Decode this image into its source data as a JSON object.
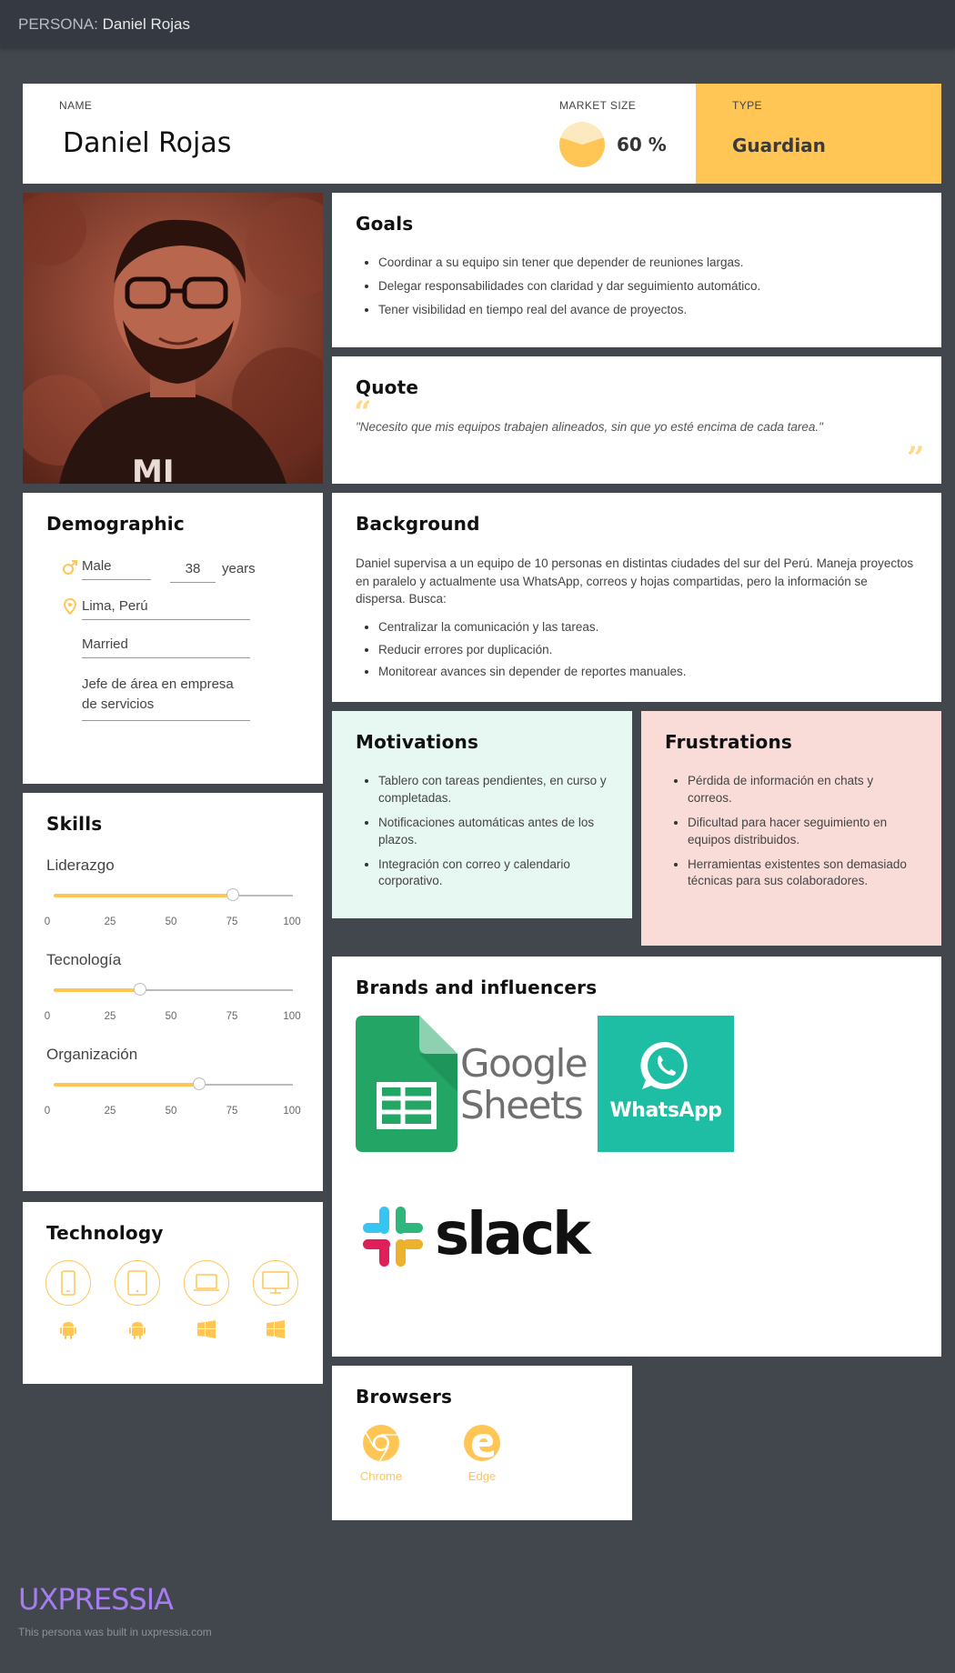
{
  "topbar": {
    "prefix": "PERSONA:",
    "name": "Daniel Rojas"
  },
  "header": {
    "name_label": "NAME",
    "name": "Daniel Rojas",
    "market_label": "MARKET SIZE",
    "market_value": "60 %",
    "market_fraction": 0.6,
    "type_label": "TYPE",
    "type": "Guardian"
  },
  "photo": {
    "alt": "Portrait of Daniel Rojas"
  },
  "goals": {
    "title": "Goals",
    "items": [
      "Coordinar a su equipo sin tener que depender de reuniones largas.",
      "Delegar responsabilidades con claridad y dar seguimiento automático.",
      "Tener visibilidad en tiempo real del avance de proyectos."
    ]
  },
  "quote": {
    "title": "Quote",
    "text": "\"Necesito que mis equipos trabajen alineados, sin que yo esté encima de cada tarea.\""
  },
  "demographic": {
    "title": "Demographic",
    "gender": "Male",
    "age": "38",
    "age_unit": "years",
    "location": "Lima, Perú",
    "status": "Married",
    "occupation": "Jefe de área en empresa de servicios"
  },
  "background": {
    "title": "Background",
    "paragraph": "Daniel supervisa a un equipo de 10 personas en distintas ciudades del sur del Perú. Maneja proyectos en paralelo y actualmente usa WhatsApp, correos y hojas compartidas, pero la información se dispersa. Busca:",
    "items": [
      "Centralizar la comunicación y las tareas.",
      "Reducir errores por duplicación.",
      "Monitorear avances sin depender de reportes manuales."
    ]
  },
  "motivations": {
    "title": "Motivations",
    "items": [
      "Tablero con tareas pendientes, en curso y completadas.",
      "Notificaciones automáticas antes de los plazos.",
      "Integración con correo y calendario corporativo."
    ]
  },
  "frustrations": {
    "title": "Frustrations",
    "items": [
      "Pérdida de información en chats y correos.",
      "Dificultad para hacer seguimiento en equipos distribuidos.",
      "Herramientas existentes son demasiado técnicas para sus colaboradores."
    ]
  },
  "skills": {
    "title": "Skills",
    "ticks": [
      "0",
      "25",
      "50",
      "75",
      "100"
    ],
    "items": [
      {
        "name": "Liderazgo",
        "value": 75
      },
      {
        "name": "Tecnología",
        "value": 36
      },
      {
        "name": "Organización",
        "value": 61
      }
    ]
  },
  "technology": {
    "title": "Technology",
    "devices": [
      "smartphone-icon",
      "tablet-icon",
      "laptop-icon",
      "desktop-icon"
    ],
    "os": [
      "android-icon",
      "android-icon",
      "windows-icon",
      "windows-icon"
    ]
  },
  "brands": {
    "title": "Brands and influencers",
    "items": [
      {
        "name": "Google Sheets",
        "line1": "Google",
        "line2": "Sheets"
      },
      {
        "name": "WhatsApp",
        "label": "WhatsApp"
      },
      {
        "name": "Slack",
        "label": "slack"
      }
    ]
  },
  "browsers": {
    "title": "Browsers",
    "items": [
      "Chrome",
      "Edge"
    ]
  },
  "footer": {
    "logo": "UXPRESSIA",
    "note": "This persona was built in uxpressia.com"
  },
  "colors": {
    "accent": "#ffc655",
    "page_bg": "#42464d",
    "motivations_bg": "#e7f7f2",
    "frustrations_bg": "#f9dcd8",
    "logo": "#a67cf0"
  }
}
